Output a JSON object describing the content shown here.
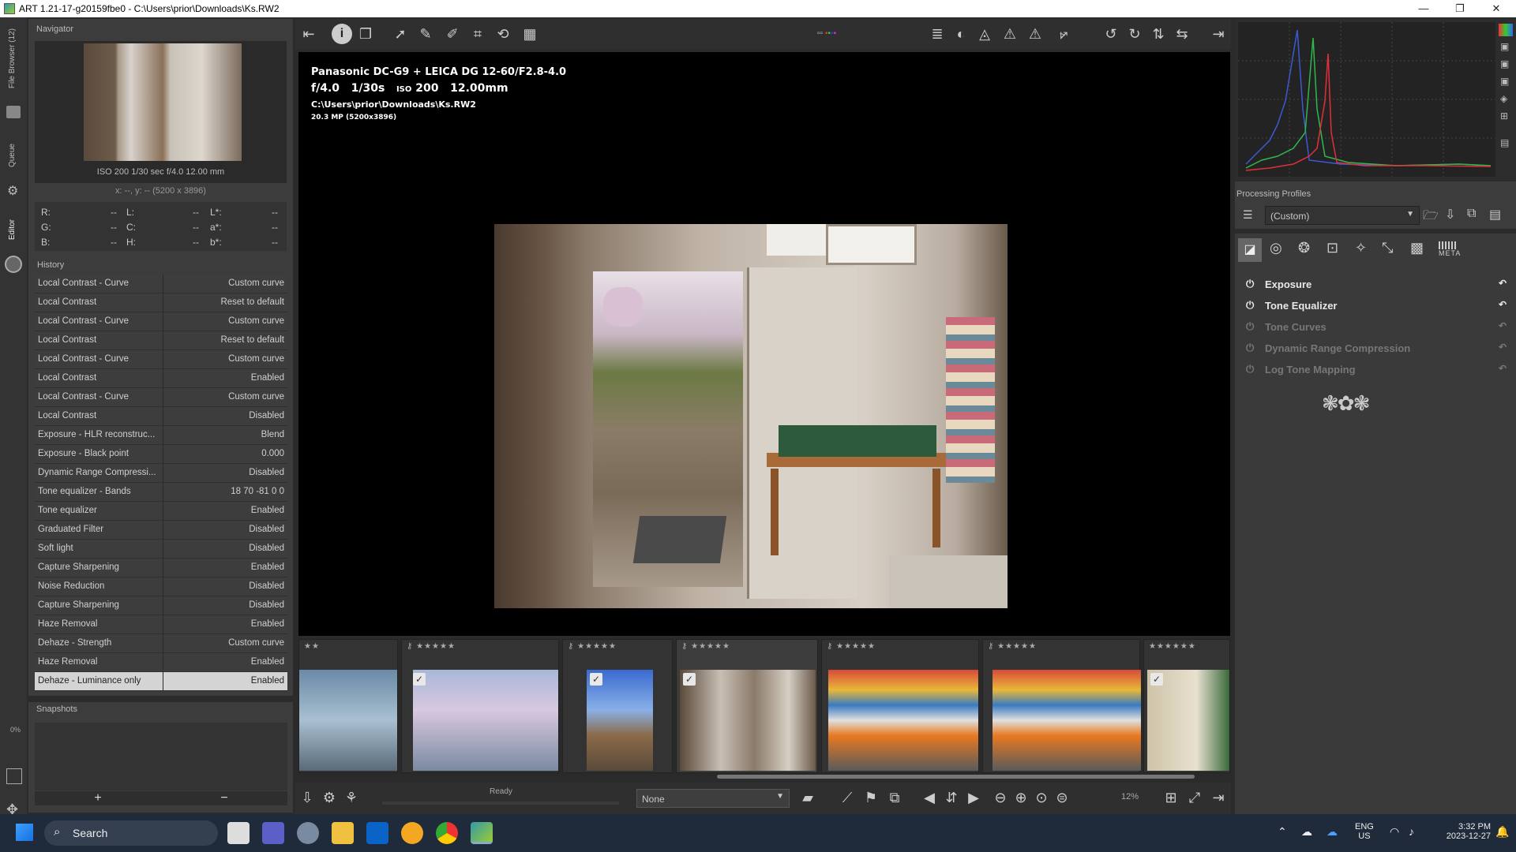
{
  "window": {
    "title": "ART 1.21-17-g20159fbe0 - C:\\Users\\prior\\Downloads\\Ks.RW2",
    "minimize": "—",
    "maximize": "❐",
    "close": "✕"
  },
  "leftstrip": {
    "file_browser": "File Browser (12)",
    "queue": "Queue",
    "editor": "Editor",
    "zoom": "0%"
  },
  "navigator": {
    "title": "Navigator",
    "exif": "ISO 200   1/30 sec   f/4.0   12.00 mm",
    "coords": "x: --, y: --    (5200 x 3896)",
    "values": [
      {
        "k1": "R:",
        "v1": "--",
        "k2": "L:",
        "v2": "--",
        "k3": "L*:",
        "v3": "--"
      },
      {
        "k1": "G:",
        "v1": "--",
        "k2": "C:",
        "v2": "--",
        "k3": "a*:",
        "v3": "--"
      },
      {
        "k1": "B:",
        "v1": "--",
        "k2": "H:",
        "v2": "--",
        "k3": "b*:",
        "v3": "--"
      }
    ]
  },
  "history": {
    "title": "History",
    "items": [
      {
        "label": "Local Contrast - Curve",
        "value": "Custom curve"
      },
      {
        "label": "Local Contrast",
        "value": "Reset to default"
      },
      {
        "label": "Local Contrast - Curve",
        "value": "Custom curve"
      },
      {
        "label": "Local Contrast",
        "value": "Reset to default"
      },
      {
        "label": "Local Contrast - Curve",
        "value": "Custom curve"
      },
      {
        "label": "Local Contrast",
        "value": "Enabled"
      },
      {
        "label": "Local Contrast - Curve",
        "value": "Custom curve"
      },
      {
        "label": "Local Contrast",
        "value": "Disabled"
      },
      {
        "label": "Exposure - HLR reconstruc...",
        "value": "Blend"
      },
      {
        "label": "Exposure - Black point",
        "value": "0.000"
      },
      {
        "label": "Dynamic Range Compressi...",
        "value": "Disabled"
      },
      {
        "label": "Tone equalizer - Bands",
        "value": "18 70 -81 0 0"
      },
      {
        "label": "Tone equalizer",
        "value": "Enabled"
      },
      {
        "label": "Graduated Filter",
        "value": "Disabled"
      },
      {
        "label": "Soft light",
        "value": "Disabled"
      },
      {
        "label": "Capture Sharpening",
        "value": "Enabled"
      },
      {
        "label": "Noise Reduction",
        "value": "Disabled"
      },
      {
        "label": "Capture Sharpening",
        "value": "Disabled"
      },
      {
        "label": "Haze Removal",
        "value": "Enabled"
      },
      {
        "label": "Dehaze - Strength",
        "value": "Custom curve"
      },
      {
        "label": "Haze Removal",
        "value": "Enabled"
      },
      {
        "label": "Dehaze - Luminance only",
        "value": "Enabled"
      }
    ]
  },
  "snapshots": {
    "title": "Snapshots",
    "add": "+",
    "remove": "−"
  },
  "viewer": {
    "camera": "Panasonic DC-G9 + LEICA DG 12-60/F2.8-4.0",
    "aperture": "f/4.0",
    "shutter": "1/30s",
    "iso_label": "ISO",
    "iso": "200",
    "focal": "12.00mm",
    "path": "C:\\Users\\prior\\Downloads\\Ks.RW2",
    "mp": "20.3 MP (5200x3896)"
  },
  "status": {
    "ready": "Ready",
    "preset": "None",
    "zoom": "12%"
  },
  "profiles": {
    "title": "Processing Profiles",
    "value": "(Custom)"
  },
  "tools": {
    "meta": "META",
    "items": [
      {
        "label": "Exposure",
        "enabled": true
      },
      {
        "label": "Tone Equalizer",
        "enabled": true
      },
      {
        "label": "Tone Curves",
        "enabled": false
      },
      {
        "label": "Dynamic Range Compression",
        "enabled": false
      },
      {
        "label": "Log Tone Mapping",
        "enabled": false
      }
    ]
  },
  "taskbar": {
    "search": "Search",
    "lang1": "ENG",
    "lang2": "US",
    "time": "3:32 PM",
    "date": "2023-12-27"
  }
}
